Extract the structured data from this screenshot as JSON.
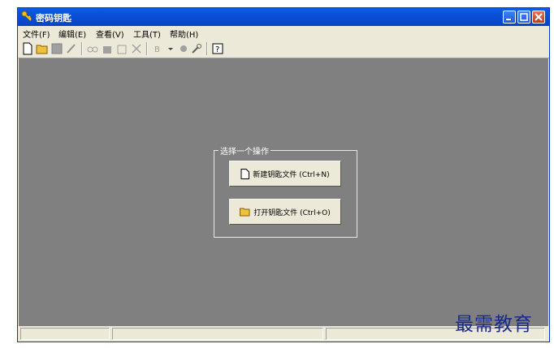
{
  "window": {
    "title": "密码钥匙"
  },
  "menu": [
    {
      "label": "文件(F)"
    },
    {
      "label": "编辑(E)"
    },
    {
      "label": "查看(V)"
    },
    {
      "label": "工具(T)"
    },
    {
      "label": "帮助(H)"
    }
  ],
  "actions": {
    "group_label": "选择一个操作",
    "new_label": "新建钥匙文件 (Ctrl+N)",
    "open_label": "打开钥匙文件 (Ctrl+O)"
  },
  "watermark": "最需教育",
  "colors": {
    "client_bg": "#808080",
    "titlebar": "#0a5fe8",
    "chrome": "#ece9d8"
  }
}
